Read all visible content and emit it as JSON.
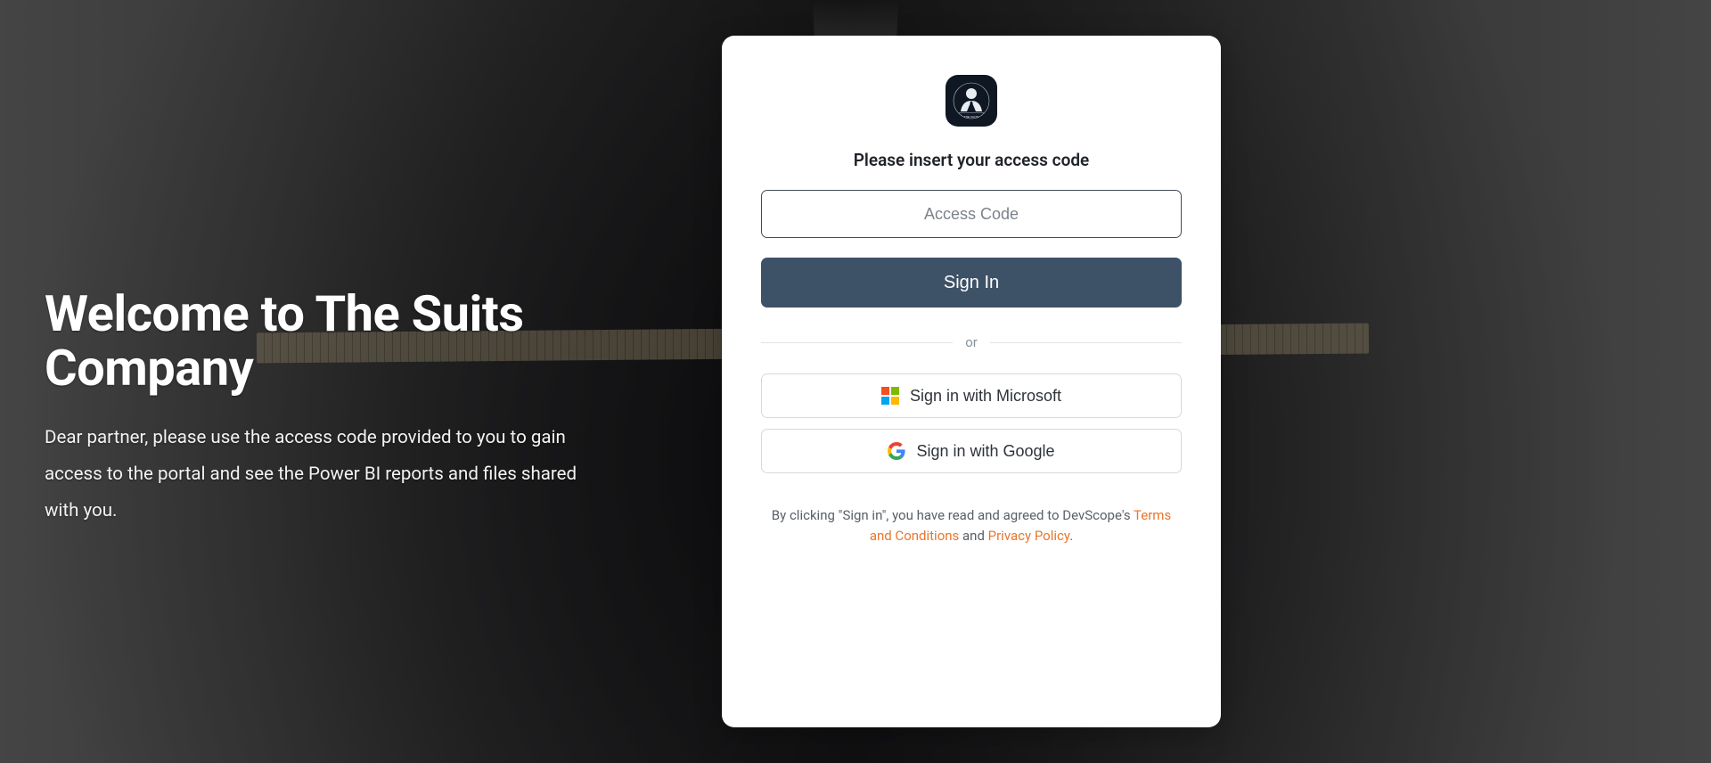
{
  "hero": {
    "title": "Welcome to The Suits Company",
    "subtitle": "Dear partner, please use the access code provided to you to gain access to the portal and see the Power BI reports and files shared with you."
  },
  "logo": {
    "label": "THE SUITS"
  },
  "form": {
    "prompt": "Please insert your access code",
    "access_code_placeholder": "Access Code",
    "access_code_value": "",
    "signin_label": "Sign In"
  },
  "divider": {
    "label": "or"
  },
  "sso": {
    "microsoft_label": "Sign in with Microsoft",
    "google_label": "Sign in with Google"
  },
  "legal": {
    "prefix": "By clicking \"Sign in\", you have read and agreed to DevScope's ",
    "terms_label": "Terms and Conditions",
    "joiner": " and ",
    "privacy_label": "Privacy Policy",
    "suffix": "."
  }
}
